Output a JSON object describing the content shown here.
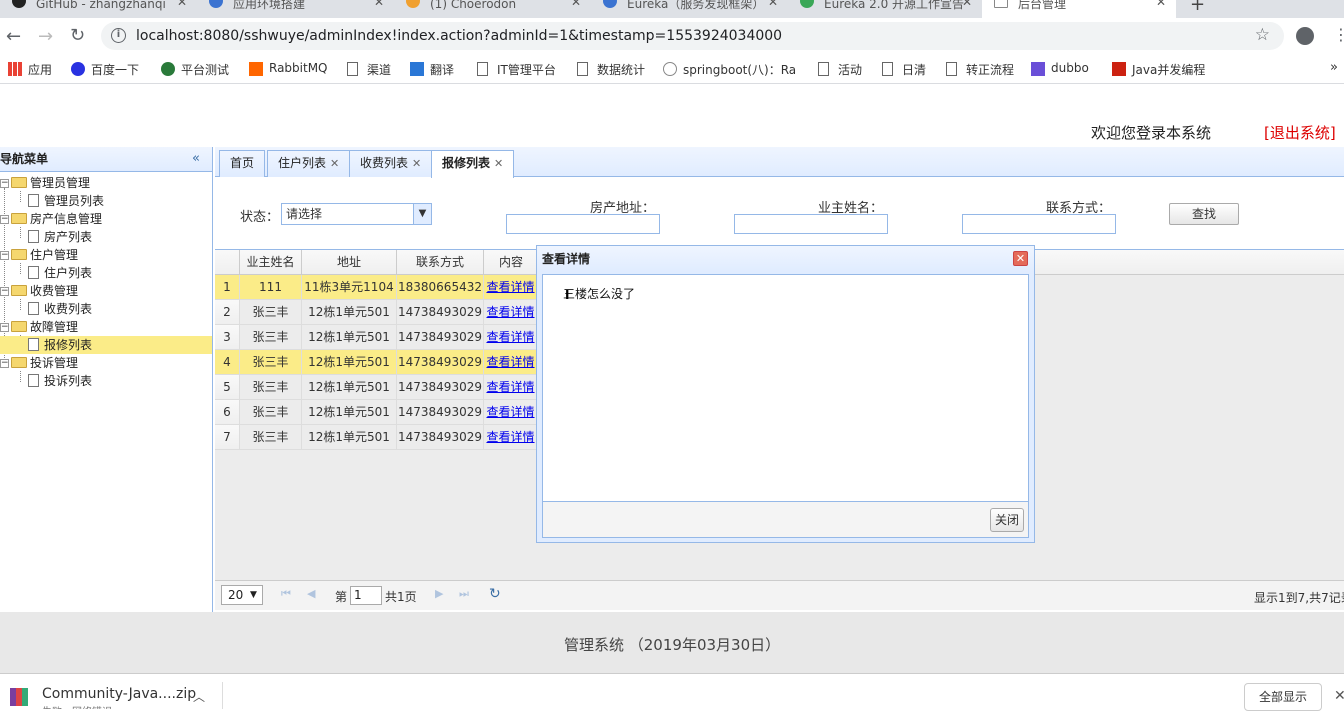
{
  "browser": {
    "tabs": [
      {
        "label": "GitHub - zhangzhanqi"
      },
      {
        "label": "应用环境搭建"
      },
      {
        "label": "(1) Choerodon"
      },
      {
        "label": "Eureka（服务发现框架）"
      },
      {
        "label": "Eureka 2.0 开源工作宣告"
      },
      {
        "label": "后台管理"
      }
    ],
    "url": "localhost:8080/sshwuye/adminIndex!index.action?adminId=1&timestamp=1553924034000",
    "bookmarks": [
      "应用",
      "百度一下",
      "平台测试",
      "RabbitMQ",
      "渠道",
      "翻译",
      "IT管理平台",
      "数据统计",
      "springboot(八)：Ra",
      "活动",
      "日清",
      "转正流程",
      "dubbo",
      "Java并发编程"
    ]
  },
  "header": {
    "welcome": "欢迎您登录本系统",
    "logout": "[退出系统]"
  },
  "nav": {
    "title": "导航菜单",
    "groups": [
      {
        "label": "管理员管理",
        "child": "管理员列表"
      },
      {
        "label": "房产信息管理",
        "child": "房产列表"
      },
      {
        "label": "住户管理",
        "child": "住户列表"
      },
      {
        "label": "收费管理",
        "child": "收费列表"
      },
      {
        "label": "故障管理",
        "child": "报修列表"
      },
      {
        "label": "投诉管理",
        "child": "投诉列表"
      }
    ]
  },
  "tabs": [
    "首页",
    "住户列表",
    "收费列表",
    "报修列表"
  ],
  "search": {
    "status_label": "状态：",
    "status_value": "请选择",
    "address_label": "房产地址：",
    "owner_label": "业主姓名：",
    "contact_label": "联系方式：",
    "find_label": "查找"
  },
  "grid": {
    "headers": [
      "业主姓名",
      "地址",
      "联系方式",
      "内容"
    ],
    "rows": [
      {
        "n": "1",
        "name": "111",
        "addr": "11栋3单元1104",
        "phone": "18380665432",
        "link": "查看详情"
      },
      {
        "n": "2",
        "name": "张三丰",
        "addr": "12栋1单元501",
        "phone": "14738493029",
        "link": "查看详情"
      },
      {
        "n": "3",
        "name": "张三丰",
        "addr": "12栋1单元501",
        "phone": "14738493029",
        "link": "查看详情"
      },
      {
        "n": "4",
        "name": "张三丰",
        "addr": "12栋1单元501",
        "phone": "14738493029",
        "link": "查看详情"
      },
      {
        "n": "5",
        "name": "张三丰",
        "addr": "12栋1单元501",
        "phone": "14738493029",
        "link": "查看详情"
      },
      {
        "n": "6",
        "name": "张三丰",
        "addr": "12栋1单元501",
        "phone": "14738493029",
        "link": "查看详情"
      },
      {
        "n": "7",
        "name": "张三丰",
        "addr": "12栋1单元501",
        "phone": "14738493029",
        "link": "查看详情"
      }
    ]
  },
  "pager": {
    "size": "20",
    "page_prefix": "第",
    "page_value": "1",
    "page_total": "共1页",
    "info": "显示1到7,共7记录"
  },
  "dialog": {
    "title": "查看详情",
    "content": "三楼怎么没了",
    "close_label": "关闭"
  },
  "footer": "管理系统 （2019年03月30日）",
  "download": {
    "file": "Community-Java....zip",
    "status": "失败 - 网络错误",
    "show_all": "全部显示"
  }
}
